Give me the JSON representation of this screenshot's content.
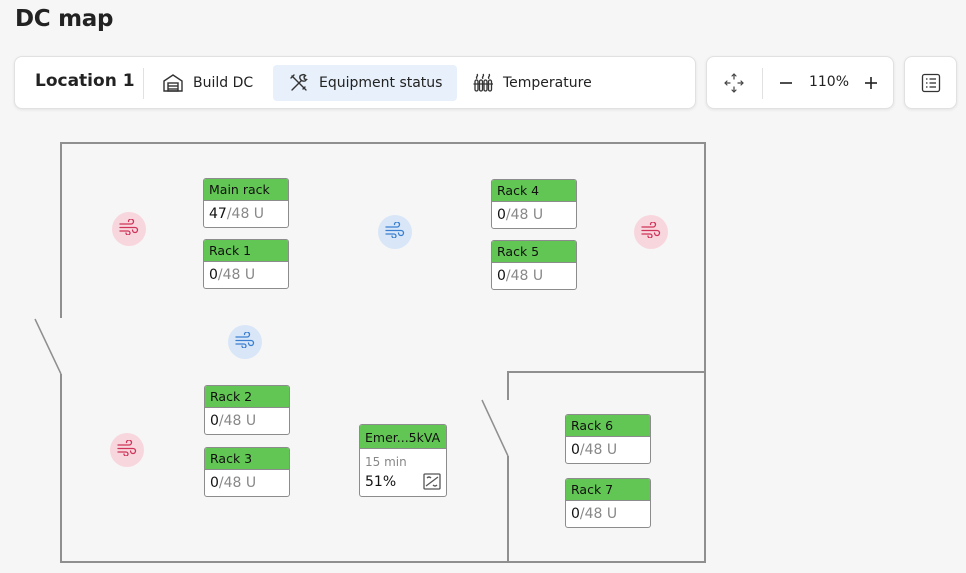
{
  "page": {
    "title": "DC map"
  },
  "toolbar": {
    "location": "Location 1",
    "tabs": [
      {
        "label": "Build DC",
        "icon": "warehouse-icon",
        "active": false
      },
      {
        "label": "Equipment status",
        "icon": "tools-icon",
        "active": true
      },
      {
        "label": "Temperature",
        "icon": "heater-icon",
        "active": false
      }
    ]
  },
  "zoom": {
    "value": "110%",
    "pan_icon": "pan-arrows-icon",
    "minus": "−",
    "plus": "+"
  },
  "list_button": {
    "icon": "list-icon"
  },
  "racks": [
    {
      "name": "Main rack",
      "used": "47",
      "total": "/48 U"
    },
    {
      "name": "Rack 1",
      "used": "0",
      "total": "/48 U"
    },
    {
      "name": "Rack 2",
      "used": "0",
      "total": "/48 U"
    },
    {
      "name": "Rack 3",
      "used": "0",
      "total": "/48 U"
    },
    {
      "name": "Rack 4",
      "used": "0",
      "total": "/48 U"
    },
    {
      "name": "Rack 5",
      "used": "0",
      "total": "/48 U"
    },
    {
      "name": "Rack 6",
      "used": "0",
      "total": "/48 U"
    },
    {
      "name": "Rack 7",
      "used": "0",
      "total": "/48 U"
    }
  ],
  "ups": {
    "name": "Emer...5kVA",
    "runtime": "15 min",
    "charge": "51%",
    "icon": "ups-status-icon"
  },
  "fans": [
    {
      "type": "hot",
      "icon": "wind-icon"
    },
    {
      "type": "cold",
      "icon": "wind-icon"
    },
    {
      "type": "hot",
      "icon": "wind-icon"
    },
    {
      "type": "cold",
      "icon": "wind-icon"
    },
    {
      "type": "hot",
      "icon": "wind-icon"
    }
  ],
  "colors": {
    "rack_ok": "#62c654",
    "active_tab": "#e7f0fb",
    "hot_fan": "#f8d6dd",
    "hot_fan_icon": "#d0335a",
    "cold_fan": "#d8e6f8",
    "cold_fan_icon": "#3a7fd0",
    "wall": "#8f8f8f"
  }
}
